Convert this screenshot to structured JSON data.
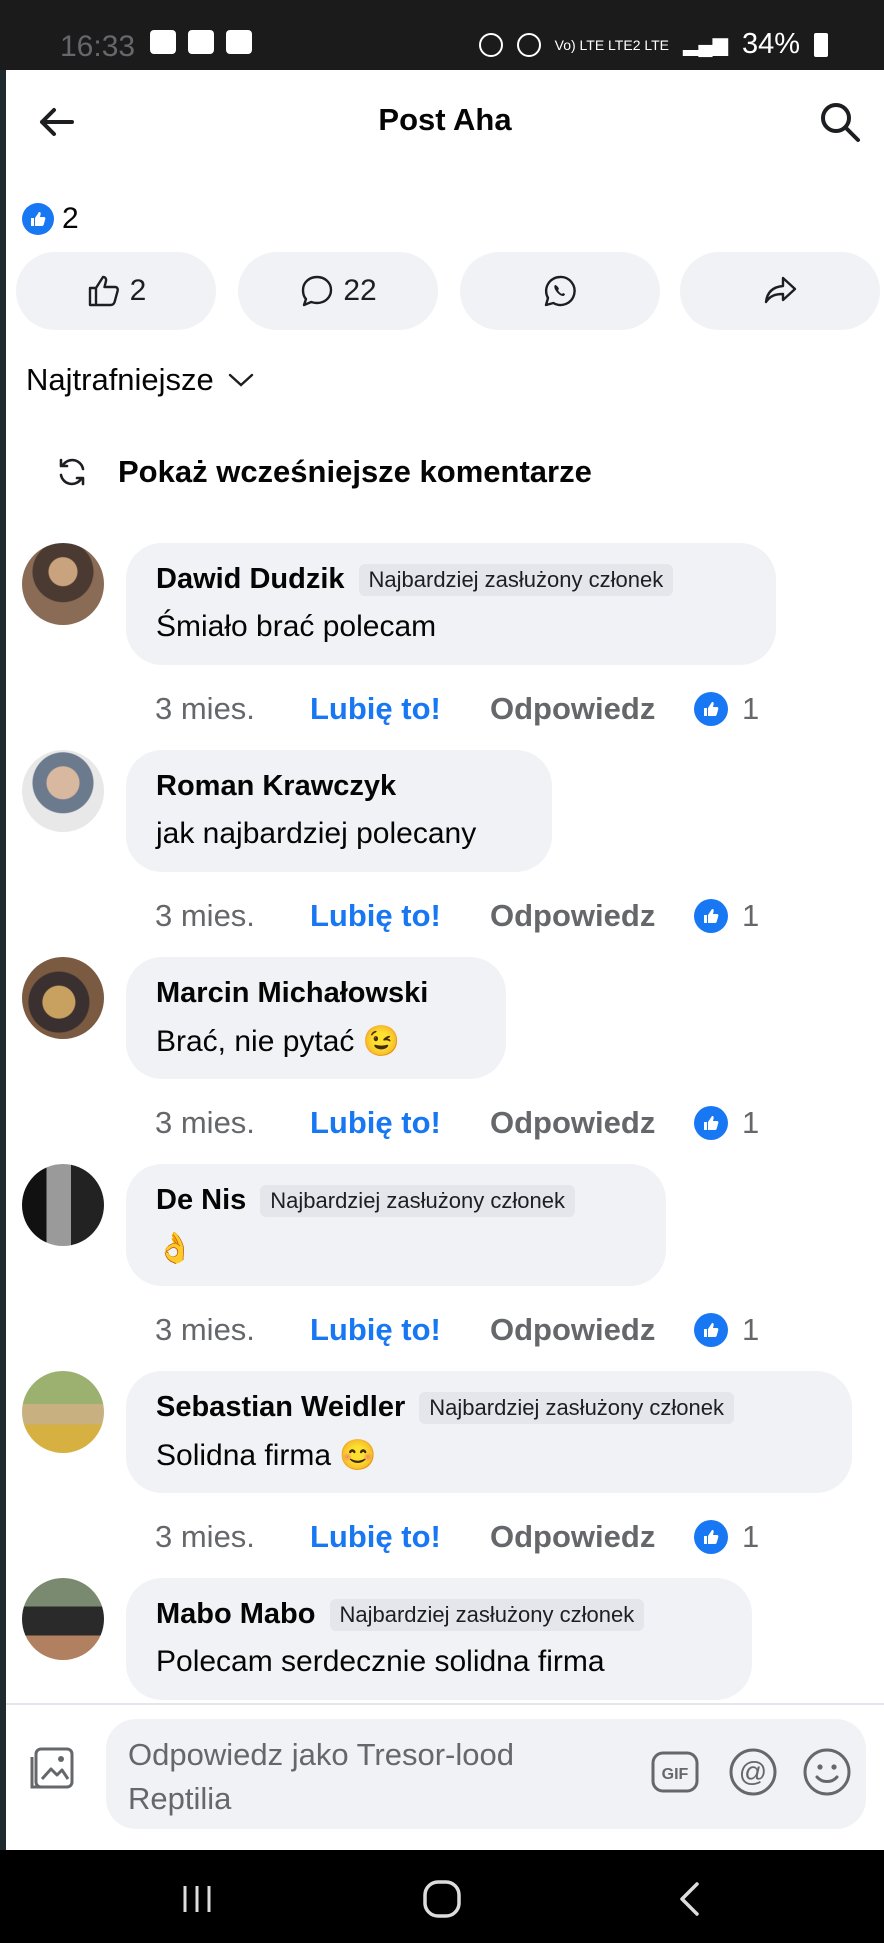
{
  "status": {
    "time": "16:33",
    "battery": "34%",
    "signal": "Vo) LTE\nLTE2 LTE"
  },
  "header": {
    "title": "Post Aha"
  },
  "post": {
    "reaction_count": "2",
    "actions": {
      "like_count": "2",
      "comment_count": "22"
    }
  },
  "sort": {
    "label": "Najtrafniejsze"
  },
  "prev_comments": {
    "label": "Pokaż wcześniejsze komentarze"
  },
  "comments": [
    {
      "author": "Dawid Dudzik",
      "badge": "Najbardziej zasłużony członek",
      "text": "Śmiało brać polecam",
      "emoji": "",
      "time": "3 mies.",
      "like": "Lubię to!",
      "reply": "Odpowiedz",
      "reactions": "1"
    },
    {
      "author": "Roman Krawczyk",
      "badge": "",
      "text": "jak najbardziej polecany",
      "emoji": "",
      "time": "3 mies.",
      "like": "Lubię to!",
      "reply": "Odpowiedz",
      "reactions": "1"
    },
    {
      "author": "Marcin Michałowski",
      "badge": "",
      "text": "Brać, nie pytać",
      "emoji": "😉",
      "time": "3 mies.",
      "like": "Lubię to!",
      "reply": "Odpowiedz",
      "reactions": "1"
    },
    {
      "author": "De Nis",
      "badge": "Najbardziej zasłużony członek",
      "text": "",
      "emoji": "👌",
      "time": "3 mies.",
      "like": "Lubię to!",
      "reply": "Odpowiedz",
      "reactions": "1"
    },
    {
      "author": "Sebastian Weidler",
      "badge": "Najbardziej zasłużony członek",
      "text": "Solidna firma",
      "emoji": "😊",
      "time": "3 mies.",
      "like": "Lubię to!",
      "reply": "Odpowiedz",
      "reactions": "1"
    },
    {
      "author": "Mabo Mabo",
      "badge": "Najbardziej zasłużony członek",
      "text": "Polecam serdecznie solidna firma",
      "emoji": "",
      "time": "",
      "like": "",
      "reply": "",
      "reactions": ""
    }
  ],
  "composer": {
    "placeholder": "Odpowiedz jako Tresor-lood Reptilia"
  },
  "colors": {
    "accent": "#1877f2",
    "bubble": "#f0f2f5",
    "muted": "#65676b"
  },
  "icons": [
    "back-arrow-icon",
    "search-icon",
    "like-icon",
    "comment-icon",
    "whatsapp-icon",
    "share-icon",
    "chevron-down-icon",
    "refresh-icon",
    "photo-icon",
    "gif-icon",
    "at-icon",
    "emoji-icon"
  ]
}
